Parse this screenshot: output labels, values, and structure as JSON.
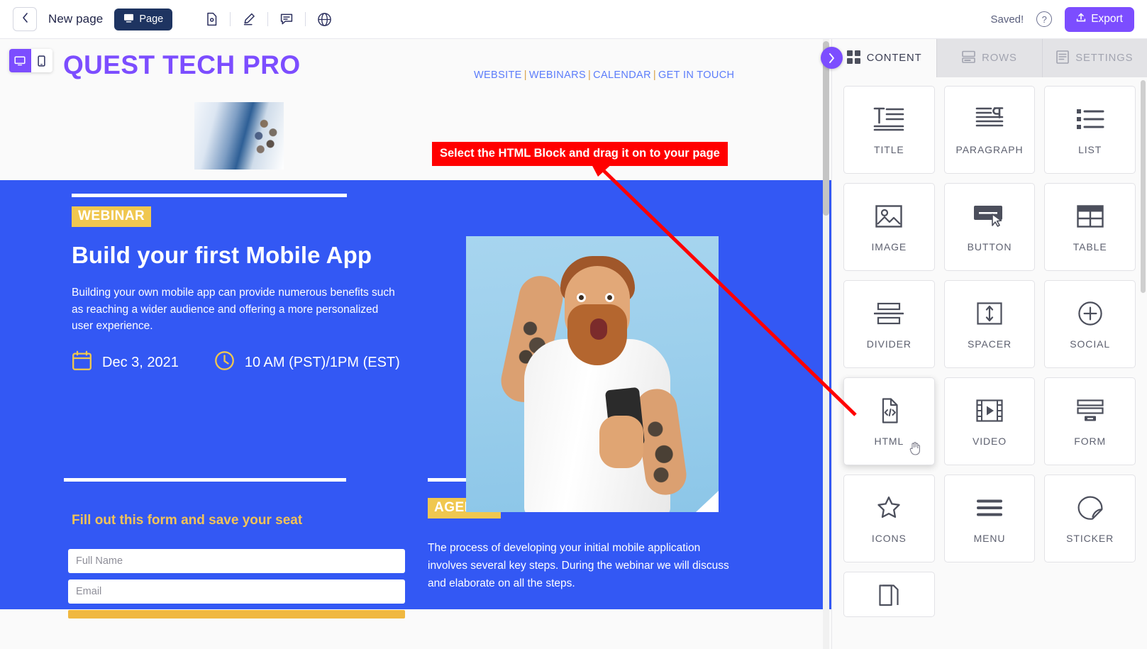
{
  "toolbar": {
    "back_icon": "chevron-left-icon",
    "page_title": "New page",
    "page_chip_label": "Page",
    "page_chip_icon": "desktop-icon",
    "icons": [
      "file-settings-icon",
      "pen-edit-icon",
      "comment-icon",
      "globe-icon"
    ],
    "saved_status": "Saved!",
    "help_icon": "question-mark-icon",
    "export_label": "Export",
    "export_icon": "upload-icon",
    "export_color": "#7c4dff"
  },
  "device_toggle": {
    "desktop_icon": "desktop-icon",
    "mobile_icon": "mobile-icon",
    "active": "desktop"
  },
  "email": {
    "brand": "QUEST TECH PRO",
    "brand_color": "#7c4dff",
    "nav": [
      {
        "label": "WEBSITE"
      },
      {
        "label": "WEBINARS"
      },
      {
        "label": "CALENDAR"
      },
      {
        "label": "GET IN TOUCH"
      }
    ],
    "nav_separator": "|",
    "nav_color": "#5b7cfa",
    "hero": {
      "background": "#3358f4",
      "badge": "WEBINAR",
      "badge_color": "#f0c74f",
      "title": "Build your first Mobile App",
      "body": "Building your own mobile app can provide numerous benefits such as reaching a wider audience and offering a more personalized user experience.",
      "date_icon": "calendar-icon",
      "date": "Dec 3, 2021",
      "time_icon": "clock-icon",
      "time": "10 AM (PST)/1PM (EST)",
      "photo_alt": "surprised-bearded-man-holding-phone"
    },
    "form": {
      "heading": "Fill out this form and save your seat",
      "heading_color": "#f2c357",
      "fields": [
        {
          "placeholder": "Full Name"
        },
        {
          "placeholder": "Email"
        }
      ]
    },
    "agenda": {
      "badge": "AGENDA",
      "body": "The process of developing your initial mobile application involves several key steps. During the webinar we will discuss and elaborate on all the steps."
    }
  },
  "annotation": {
    "text": "Select the HTML Block and drag it on to your page",
    "background": "#ff0000",
    "text_color": "#ffffff",
    "arrow_color": "#ff0000"
  },
  "panel": {
    "tabs": [
      {
        "label": "CONTENT",
        "icon": "grid-icon",
        "active": true
      },
      {
        "label": "ROWS",
        "icon": "rows-icon",
        "active": false
      },
      {
        "label": "SETTINGS",
        "icon": "settings-doc-icon",
        "active": false
      }
    ],
    "collapse_icon": "chevron-right-icon",
    "blocks": [
      {
        "label": "TITLE",
        "icon": "title-icon",
        "selected": false
      },
      {
        "label": "PARAGRAPH",
        "icon": "paragraph-icon",
        "selected": false
      },
      {
        "label": "LIST",
        "icon": "list-icon",
        "selected": false
      },
      {
        "label": "IMAGE",
        "icon": "image-icon",
        "selected": false
      },
      {
        "label": "BUTTON",
        "icon": "button-icon",
        "selected": false
      },
      {
        "label": "TABLE",
        "icon": "table-icon",
        "selected": false
      },
      {
        "label": "DIVIDER",
        "icon": "divider-icon",
        "selected": false
      },
      {
        "label": "SPACER",
        "icon": "spacer-icon",
        "selected": false
      },
      {
        "label": "SOCIAL",
        "icon": "social-plus-icon",
        "selected": false
      },
      {
        "label": "HTML",
        "icon": "html-code-icon",
        "selected": true
      },
      {
        "label": "VIDEO",
        "icon": "video-icon",
        "selected": false
      },
      {
        "label": "FORM",
        "icon": "form-icon",
        "selected": false
      },
      {
        "label": "ICONS",
        "icon": "star-icon",
        "selected": false
      },
      {
        "label": "MENU",
        "icon": "hamburger-menu-icon",
        "selected": false
      },
      {
        "label": "STICKER",
        "icon": "sticker-icon",
        "selected": false
      },
      {
        "label": "",
        "icon": "pages-icon",
        "selected": false
      }
    ]
  }
}
